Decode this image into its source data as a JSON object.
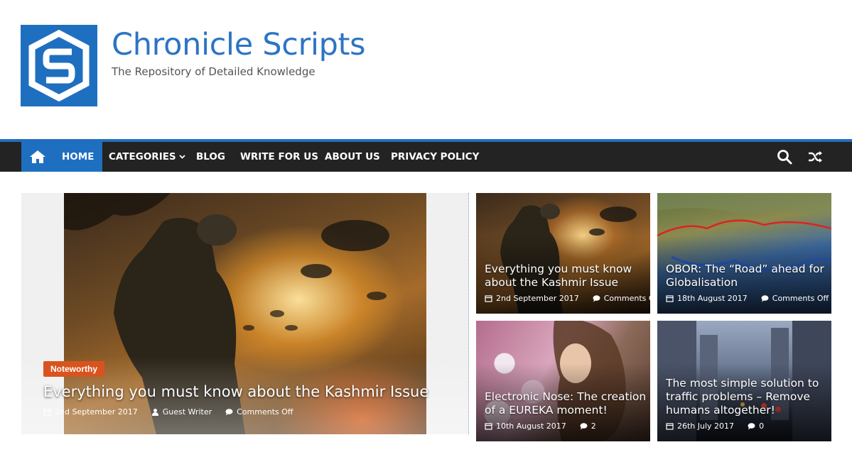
{
  "site": {
    "title": "Chronicle Scripts",
    "tagline": "The Repository of Detailed Knowledge",
    "logo_icon": "cs-logo-icon",
    "brand_color": "#1f6fc0"
  },
  "nav": {
    "home_icon": "home-icon",
    "items": [
      "HOME",
      "CATEGORIES",
      "BLOG",
      "WRITE FOR US",
      "ABOUT US",
      "PRIVACY POLICY"
    ],
    "search_icon": "search-icon",
    "random_icon": "shuffle-icon"
  },
  "featured": {
    "category": "Noteworthy",
    "title": "Everything you must know about the Kashmir Issue",
    "date": "2nd September 2017",
    "author": "Guest Writer",
    "comments": "Comments Off",
    "badge_color": "#d9531e"
  },
  "cards": [
    {
      "title": "Everything you must know about the Kashmir Issue",
      "date": "2nd September 2017",
      "comments": "Comments Off"
    },
    {
      "title": "OBOR: The “Road” ahead for Globalisation",
      "date": "18th August 2017",
      "comments": "Comments Off"
    },
    {
      "title": "Electronic Nose: The creation of a EUREKA moment!",
      "date": "10th August 2017",
      "comments": "2"
    },
    {
      "title": "The most simple solution to traffic problems – Remove humans altogether!",
      "date": "26th July 2017",
      "comments": "0"
    }
  ]
}
